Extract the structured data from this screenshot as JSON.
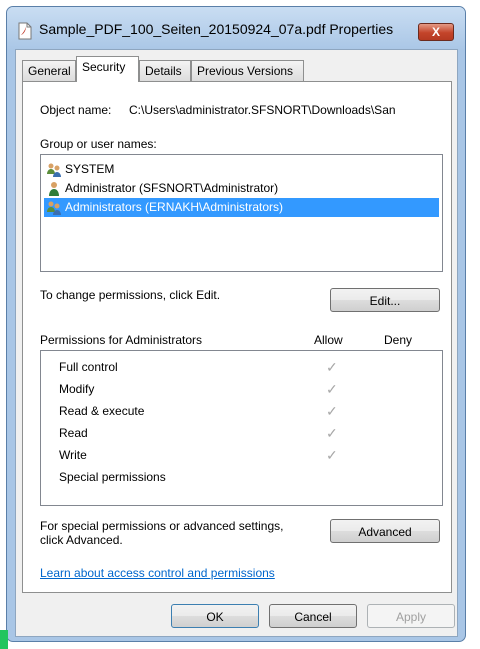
{
  "window": {
    "title": "Sample_PDF_100_Seiten_20150924_07a.pdf Properties",
    "close_label": "X"
  },
  "tabs": [
    {
      "label": "General",
      "active": false
    },
    {
      "label": "Security",
      "active": true
    },
    {
      "label": "Details",
      "active": false
    },
    {
      "label": "Previous Versions",
      "active": false
    }
  ],
  "security": {
    "object_name_label": "Object name:",
    "object_name_value": "C:\\Users\\administrator.SFSNORT\\Downloads\\San",
    "group_label": "Group or user names:",
    "users": [
      {
        "name": "SYSTEM",
        "icon": "group-users-icon",
        "selected": false
      },
      {
        "name": "Administrator (SFSNORT\\Administrator)",
        "icon": "user-icon",
        "selected": false
      },
      {
        "name": "Administrators (ERNAKH\\Administrators)",
        "icon": "group-users-icon",
        "selected": true
      }
    ],
    "change_text": "To change permissions, click Edit.",
    "edit_label": "Edit...",
    "permissions_for_label": "Permissions for Administrators",
    "allow_header": "Allow",
    "deny_header": "Deny",
    "permissions": [
      {
        "name": "Full control",
        "allow": "✓",
        "deny": ""
      },
      {
        "name": "Modify",
        "allow": "✓",
        "deny": ""
      },
      {
        "name": "Read & execute",
        "allow": "✓",
        "deny": ""
      },
      {
        "name": "Read",
        "allow": "✓",
        "deny": ""
      },
      {
        "name": "Write",
        "allow": "✓",
        "deny": ""
      },
      {
        "name": "Special permissions",
        "allow": "",
        "deny": ""
      }
    ],
    "special_text_line1": "For special permissions or advanced settings,",
    "special_text_line2": "click Advanced.",
    "advanced_label": "Advanced",
    "learn_link": "Learn about access control and permissions"
  },
  "buttons": {
    "ok": "OK",
    "cancel": "Cancel",
    "apply": "Apply"
  },
  "colors": {
    "selection": "#3399ff",
    "link": "#0066cc",
    "check": "#a8a8a8",
    "frame": "#a9c6e6"
  }
}
